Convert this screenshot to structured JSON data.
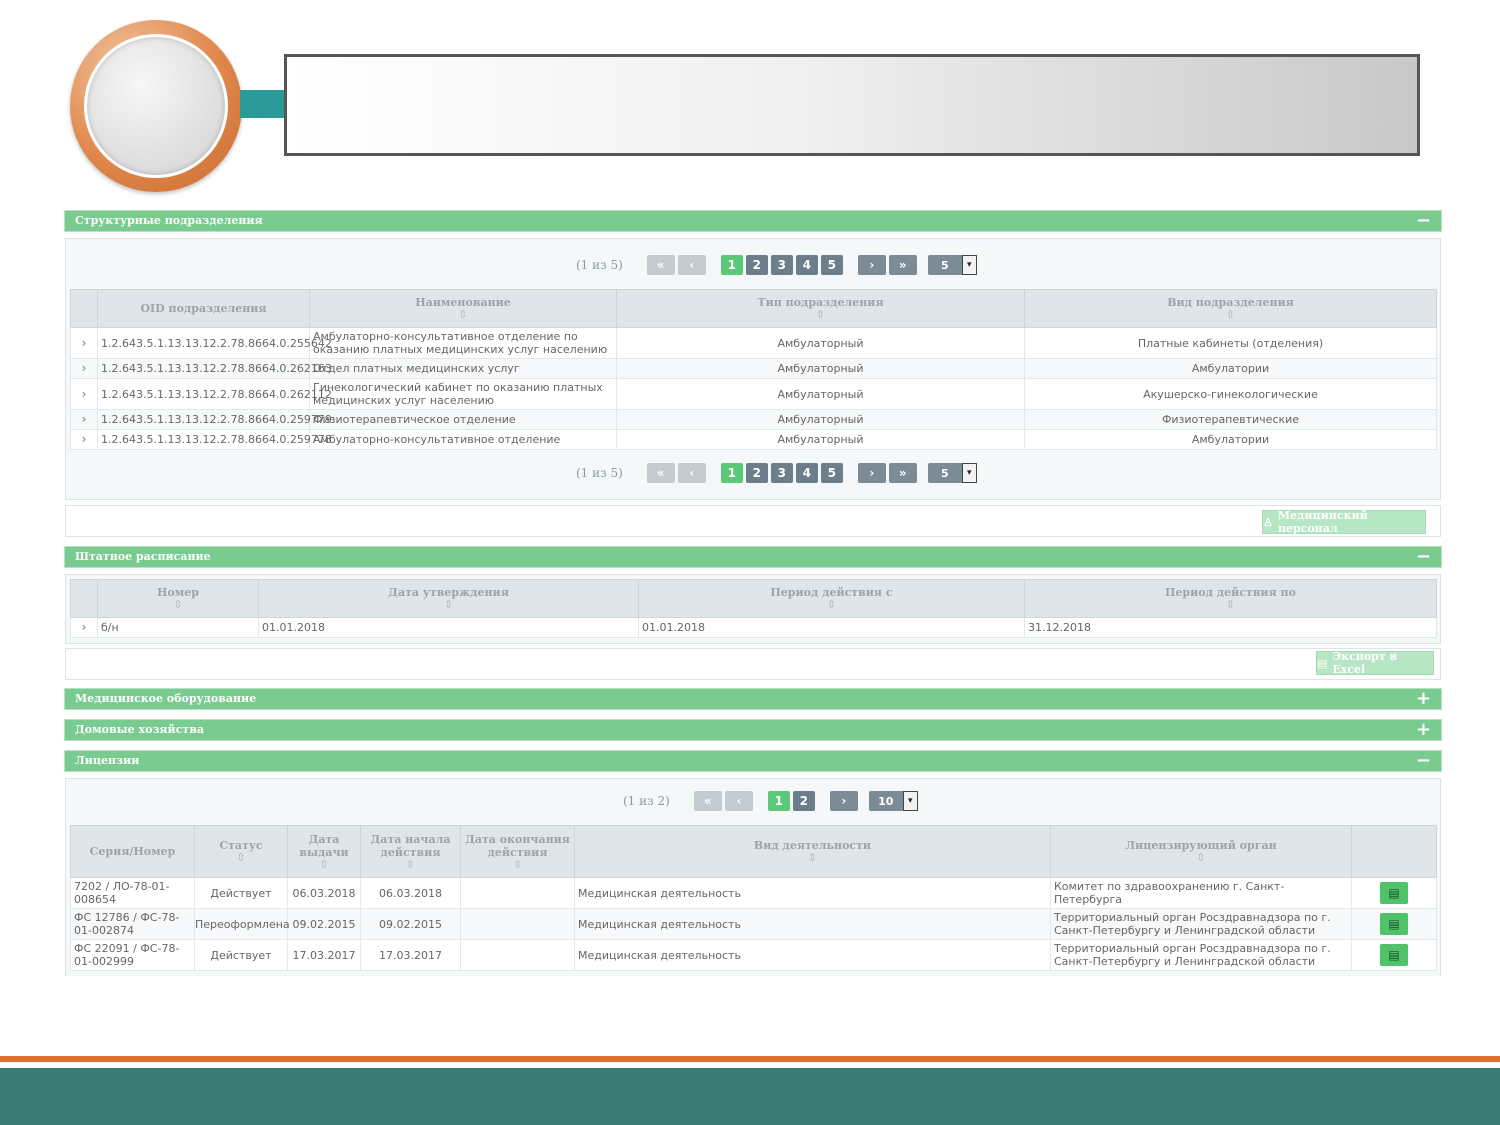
{
  "structural_units": {
    "title": "Структурные подразделения",
    "toggle": "−",
    "paginator": {
      "info": "(1 из 5)",
      "first": "«",
      "prev": "‹",
      "pages": [
        "1",
        "2",
        "3",
        "4",
        "5"
      ],
      "next": "›",
      "last": "»",
      "per_page": "5"
    },
    "columns": [
      "OID подразделения",
      "Наименование",
      "Тип подразделения",
      "Вид подразделения"
    ],
    "rows": [
      {
        "oid": "1.2.643.5.1.13.13.12.2.78.8664.0.255642",
        "name": "Амбулаторно-консультативное отделение по оказанию платных медицинских услуг населению",
        "type": "Амбулаторный",
        "kind": "Платные кабинеты (отделения)"
      },
      {
        "oid": "1.2.643.5.1.13.13.12.2.78.8664.0.262163",
        "name": "Отдел платных медицинских услуг",
        "type": "Амбулаторный",
        "kind": "Амбулатории"
      },
      {
        "oid": "1.2.643.5.1.13.13.12.2.78.8664.0.262112",
        "name": "Гинекологический кабинет по оказанию платных медицинских услуг населению",
        "type": "Амбулаторный",
        "kind": "Акушерско-гинекологические"
      },
      {
        "oid": "1.2.643.5.1.13.13.12.2.78.8664.0.259779",
        "name": "Физиотерапевтическое отделение",
        "type": "Амбулаторный",
        "kind": "Физиотерапевтические"
      },
      {
        "oid": "1.2.643.5.1.13.13.12.2.78.8664.0.259778",
        "name": "Амбулаторно-консультативное отделение",
        "type": "Амбулаторный",
        "kind": "Амбулатории"
      }
    ],
    "staff_button": "Медицинский персонал"
  },
  "staffing": {
    "title": "Штатное расписание",
    "toggle": "−",
    "columns": [
      "Номер",
      "Дата утверждения",
      "Период действия с",
      "Период действия по"
    ],
    "rows": [
      {
        "number": "б/н",
        "approved": "01.01.2018",
        "from": "01.01.2018",
        "to": "31.12.2018"
      }
    ],
    "export_button": "Экспорт в Excel"
  },
  "equipment": {
    "title": "Медицинское оборудование",
    "toggle": "+"
  },
  "households": {
    "title": "Домовые хозяйства",
    "toggle": "+"
  },
  "licenses": {
    "title": "Лицензии",
    "toggle": "−",
    "paginator": {
      "info": "(1 из 2)",
      "first": "«",
      "prev": "‹",
      "pages": [
        "1",
        "2"
      ],
      "next": "›",
      "per_page": "10"
    },
    "columns": [
      "Серия/Номер",
      "Статус",
      "Дата выдачи",
      "Дата начала действия",
      "Дата окончания действия",
      "Вид деятельности",
      "Лицензирующий орган"
    ],
    "rows": [
      {
        "number": "7202 / ЛО-78-01-008654",
        "status": "Действует",
        "issued": "06.03.2018",
        "start": "06.03.2018",
        "end": "",
        "activity": "Медицинская деятельность",
        "authority": "Комитет по здравоохранению г. Санкт-Петербурга"
      },
      {
        "number": "ФС 12786 / ФС-78-01-002874",
        "status": "Переоформлена",
        "issued": "09.02.2015",
        "start": "09.02.2015",
        "end": "",
        "activity": "Медицинская деятельность",
        "authority": "Территориальный орган Росздравнадзора по г. Санкт-Петербургу и Ленинградской области"
      },
      {
        "number": "ФС 22091 / ФС-78-01-002999",
        "status": "Действует",
        "issued": "17.03.2017",
        "start": "17.03.2017",
        "end": "",
        "activity": "Медицинская деятельность",
        "authority": "Территориальный орган Росздравнадзора по г. Санкт-Петербургу и Ленинградской области"
      }
    ]
  },
  "icons": {
    "expander": "›",
    "sort": "⇳",
    "document": "▤",
    "dropdown": "▾",
    "staff": "♙"
  },
  "colors": {
    "panel_header": "#79cb8f",
    "page_current": "#5cc978",
    "footer_band": "#387a72",
    "footer_line": "#e07030",
    "connector": "#2a9a98"
  }
}
